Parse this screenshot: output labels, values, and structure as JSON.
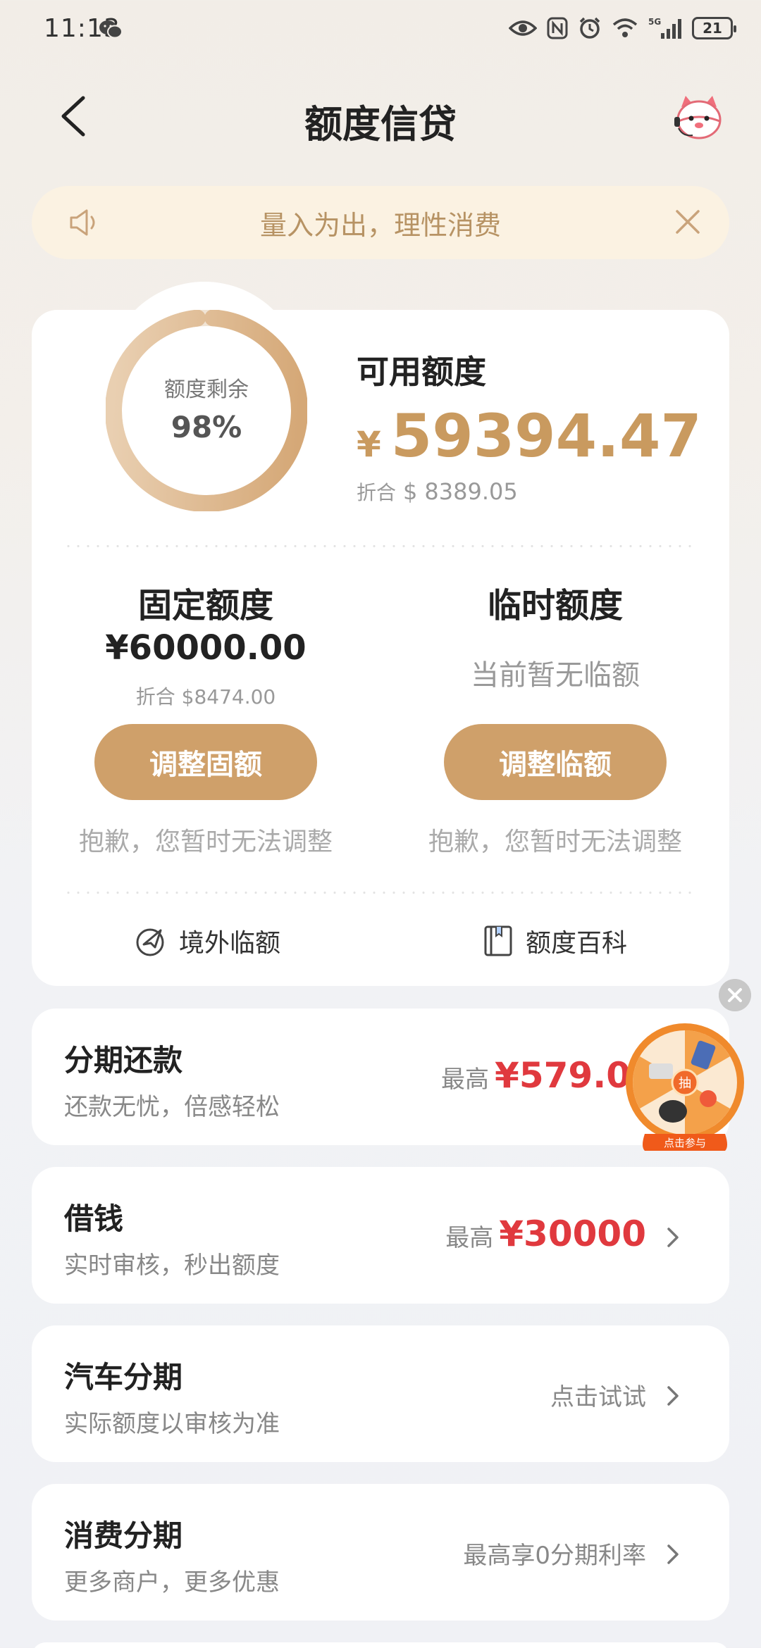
{
  "status_bar": {
    "time": "11:13",
    "battery": "21"
  },
  "header": {
    "title": "额度信贷"
  },
  "notice": {
    "text": "量入为出，理性消费"
  },
  "quota": {
    "remain_label": "额度剩余",
    "remain_percent": "98%",
    "remain_fraction": 0.98,
    "available_label": "可用额度",
    "currency_symbol": "¥",
    "available_amount": "59394.47",
    "converted_prefix": "折合",
    "converted_symbol": "$",
    "converted_amount": "8389.05",
    "fixed": {
      "title": "固定额度",
      "amount": "¥60000.00",
      "converted": "折合 $8474.00",
      "button": "调整固额",
      "hint": "抱歉，您暂时无法调整"
    },
    "temp": {
      "title": "临时额度",
      "status": "当前暂无临额",
      "button": "调整临额",
      "hint": "抱歉，您暂时无法调整"
    },
    "links": {
      "overseas": "境外临额",
      "wiki": "额度百科"
    }
  },
  "products": [
    {
      "title": "分期还款",
      "subtitle": "还款无忧，倍感轻松",
      "prefix": "最高",
      "amount": "¥579.0"
    },
    {
      "title": "借钱",
      "subtitle": "实时审核，秒出额度",
      "prefix": "最高",
      "amount": "¥30000"
    },
    {
      "title": "汽车分期",
      "subtitle": "实际额度以审核为准",
      "prefix": "点击试试",
      "amount": ""
    },
    {
      "title": "消费分期",
      "subtitle": "更多商户，更多优惠",
      "prefix": "最高享0分期利率",
      "amount": ""
    }
  ],
  "promo": {
    "center": "抽",
    "caption": "点击参与"
  },
  "colors": {
    "gold": "#cfa06a",
    "amount_gold": "#c99a5f",
    "red": "#e0393e",
    "notice_bg": "#fbf2e2"
  }
}
